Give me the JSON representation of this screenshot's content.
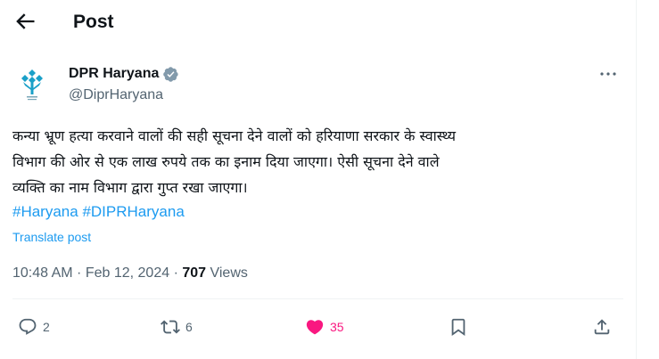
{
  "header": {
    "title": "Post"
  },
  "author": {
    "name": "DPR Haryana",
    "handle": "@DiprHaryana",
    "avatar_brand_color": "#1aa0c8"
  },
  "post": {
    "text_lines": [
      "कन्या भ्रूण हत्या करवाने वालों की सही सूचना देने वालों को हरियाणा सरकार के स्वास्थ्य",
      "विभाग की ओर से एक लाख रुपये तक का इनाम दिया जाएगा। ऐसी सूचना देने वाले",
      "व्यक्ति का नाम विभाग द्वारा गुप्त रखा जाएगा।"
    ],
    "hashtags": [
      "#Haryana",
      "#DIPRHaryana"
    ],
    "translate_label": "Translate post",
    "time": "10:48 AM",
    "sep1": " · ",
    "date": "Feb 12, 2024",
    "sep2": " · ",
    "views_count": "707",
    "views_label": " Views"
  },
  "actions": {
    "replies": "2",
    "reposts": "6",
    "likes": "35"
  },
  "colors": {
    "accent": "#1d9bf0",
    "like": "#f91880",
    "muted": "#536471",
    "divider": "#eff3f4"
  }
}
